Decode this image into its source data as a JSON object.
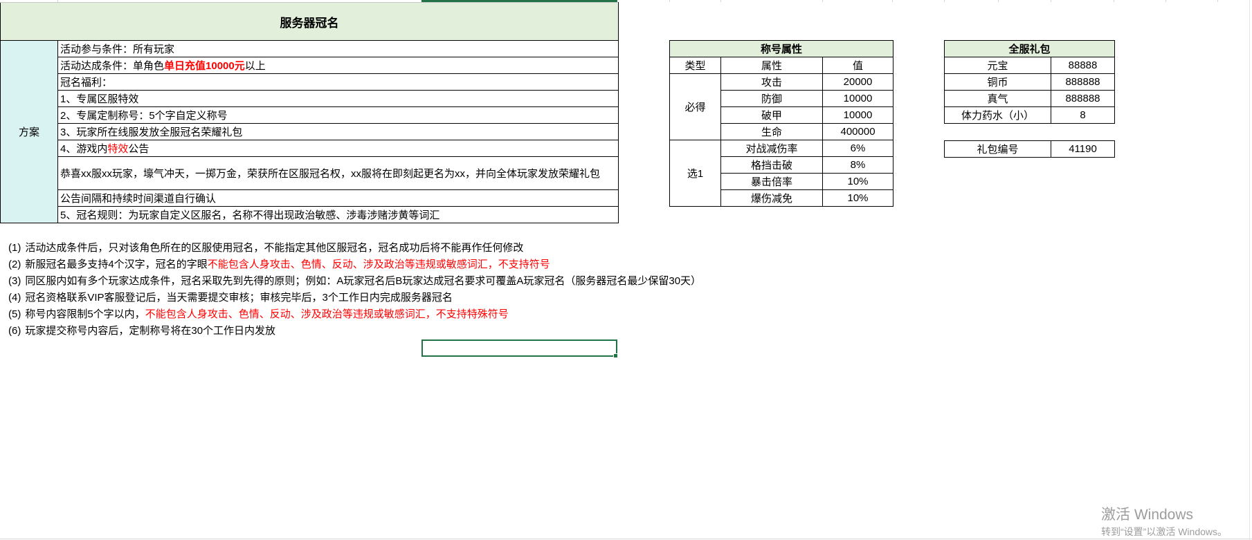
{
  "main_table": {
    "title": "服务器冠名",
    "section_label": "方案",
    "rows": [
      {
        "text": "活动参与条件：所有玩家"
      },
      {
        "text": "活动达成条件：单角色",
        "highlight": "单日充值10000元",
        "after": "以上"
      },
      {
        "text": "冠名福利："
      },
      {
        "text": "1、专属区服特效"
      },
      {
        "text": "2、专属定制称号：5个字自定义称号"
      },
      {
        "text": "3、玩家所在线服发放全服冠名荣耀礼包"
      },
      {
        "text": "4、游戏内",
        "highlight": "特效",
        "after": "公告"
      },
      {
        "text": "恭喜xx服xx玩家，壕气冲天，一掷万金，荣获所在区服冠名权，xx服将在即刻起更名为xx，并向全体玩家发放荣耀礼包"
      },
      {
        "text": "公告间隔和持续时间渠道自行确认"
      },
      {
        "text": "5、冠名规则：为玩家自定义区服名，名称不得出现政治敏感、涉毒涉赌涉黄等词汇"
      }
    ]
  },
  "title_attributes": {
    "title": "称号属性",
    "headers": [
      "类型",
      "属性",
      "值"
    ],
    "groups": [
      {
        "type": "必得",
        "items": [
          {
            "attr": "攻击",
            "value": 20000
          },
          {
            "attr": "防御",
            "value": 10000
          },
          {
            "attr": "破甲",
            "value": 10000
          },
          {
            "attr": "生命",
            "value": 400000
          }
        ]
      },
      {
        "type": "选1",
        "items": [
          {
            "attr": "对战减伤率",
            "value": "6%"
          },
          {
            "attr": "格挡击破",
            "value": "8%"
          },
          {
            "attr": "暴击倍率",
            "value": "10%"
          },
          {
            "attr": "爆伤减免",
            "value": "10%"
          }
        ]
      }
    ]
  },
  "server_gift": {
    "title": "全服礼包",
    "items": [
      {
        "name": "元宝",
        "value": 88888
      },
      {
        "name": "铜币",
        "value": 888888
      },
      {
        "name": "真气",
        "value": 888888
      },
      {
        "name": "体力药水（小）",
        "value": 8
      }
    ],
    "gift_id_label": "礼包编号",
    "gift_id": 41190
  },
  "notes": [
    {
      "num": "(1)",
      "text": "活动达成条件后，只对该角色所在的区服使用冠名，不能指定其他区服冠名，冠名成功后将不能再作任何修改"
    },
    {
      "num": "(2)",
      "text": "新服冠名最多支持4个汉字，冠名的字眼",
      "highlight": "不能包含人身攻击、色情、反动、涉及政治等违规或敏感词汇，不支持符号"
    },
    {
      "num": "(3)",
      "text": "同区服内如有多个玩家达成条件，冠名采取先到先得的原则；例如：A玩家冠名后B玩家达成冠名要求可覆盖A玩家冠名（服务器冠名最少保留30天）"
    },
    {
      "num": "(4)",
      "text": "冠名资格联系VIP客服登记后，当天需要提交审核；审核完毕后，3个工作日内完成服务器冠名"
    },
    {
      "num": "(5)",
      "text": "称号内容限制5个字以内，",
      "highlight": "不能包含人身攻击、色情、反动、涉及政治等违规或敏感词汇，不支持特殊符号"
    },
    {
      "num": "(6)",
      "text": "玩家提交称号内容后，定制称号将在30个工作日内发放"
    }
  ],
  "watermark": {
    "title": "激活 Windows",
    "subtitle": "转到“设置”以激活 Windows。"
  },
  "colors": {
    "header_fill": "#e2efda",
    "section_fill": "#d9f3f3",
    "highlight": "#ff0000",
    "selection": "#217346",
    "watermark": "#9d9d9d"
  }
}
